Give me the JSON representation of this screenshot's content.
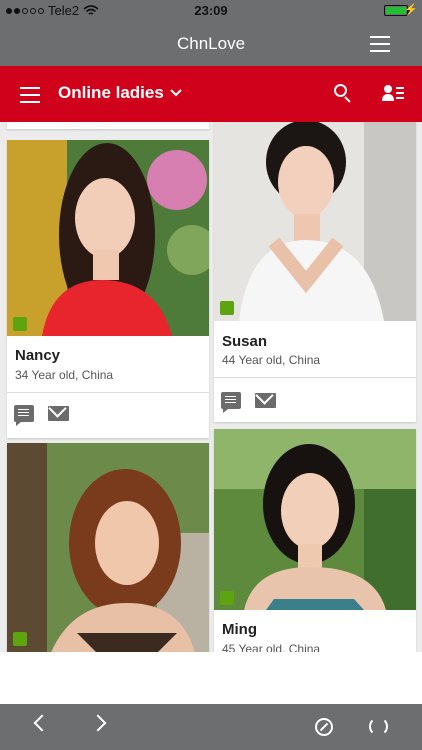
{
  "status_bar": {
    "carrier": "Tele2",
    "time": "23:09"
  },
  "app": {
    "title": "ChnLove"
  },
  "header": {
    "title": "Online ladies"
  },
  "profiles": [
    {
      "name": "Nancy",
      "info": "34 Year old, China"
    },
    {
      "name": "Susan",
      "info": "44 Year old, China"
    },
    {
      "name": "Ming",
      "info": "45 Year old, China"
    }
  ],
  "icons": {
    "status": [
      "signal-dots-icon",
      "wifi-icon",
      "battery-icon",
      "charging-bolt-icon"
    ],
    "title_bar": [
      "menu-icon"
    ],
    "header": [
      "menu-icon",
      "chevron-down-icon",
      "search-icon",
      "contacts-icon"
    ],
    "card_actions": [
      "message-icon",
      "mail-icon"
    ],
    "bottom_bar": [
      "back-arrow-icon",
      "forward-arrow-icon",
      "compass-icon",
      "refresh-icon"
    ]
  },
  "colors": {
    "accent_red": "#d0021b",
    "chrome_gray": "#6d6e70",
    "online_green": "#5ea410"
  }
}
